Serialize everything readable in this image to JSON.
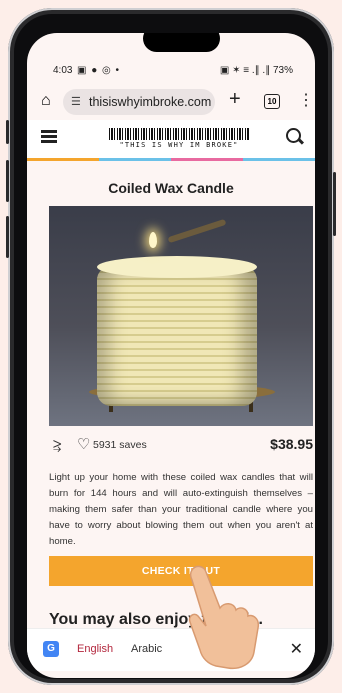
{
  "status_bar": {
    "time": "4:03",
    "notification_icons": "▣ ● ◎ •",
    "system_icons": "▣ ✶ ≡ .∥ .∥",
    "battery": "73%"
  },
  "browser": {
    "url": "thisiswhyimbroke.com",
    "tab_count": "10"
  },
  "site": {
    "logo_text": "\"THIS IS WHY IM BROKE\"",
    "stripe_colors": [
      "#f4a52d",
      "#6bc1e8",
      "#e86aa0",
      "#6bc1e8"
    ]
  },
  "product": {
    "title": "Coiled Wax Candle",
    "saves": "5931 saves",
    "price": "$38.95",
    "description": "Light up your home with these coiled wax candles that will burn for 144 hours and will auto-extinguish themselves – making them safer than your traditional candle where you have to worry about blowing them out when you aren't at home.",
    "cta_label": "CHECK IT OUT"
  },
  "next_section": {
    "heading": "You may also enjoy throwi..."
  },
  "translate_bar": {
    "source_lang": "English",
    "target_lang": "Arabic"
  },
  "colors": {
    "accent": "#f4a52d",
    "page_bg": "#fdf5f3",
    "frame": "#fdeee9"
  }
}
